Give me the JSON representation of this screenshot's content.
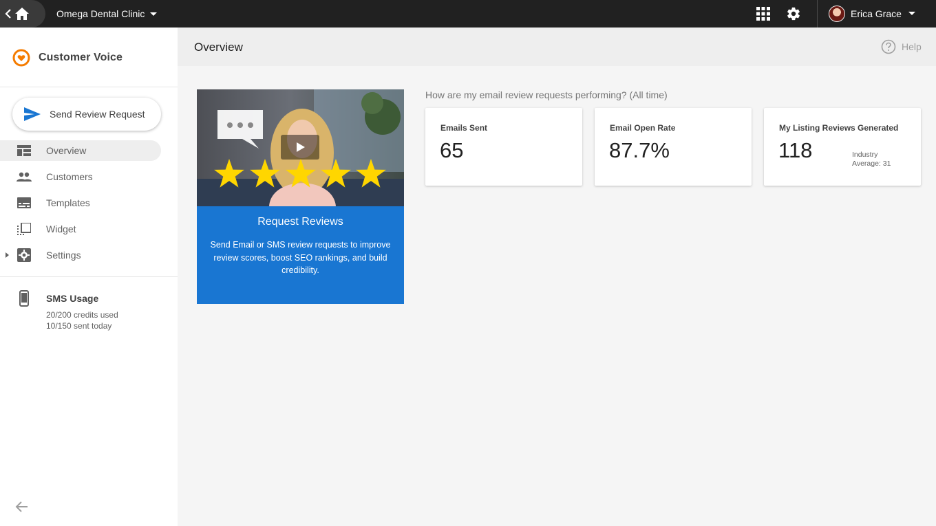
{
  "topbar": {
    "clinic_name": "Omega Dental Clinic",
    "user_name": "Erica Grace"
  },
  "sidebar": {
    "app_name": "Customer Voice",
    "send_button_label": "Send Review Request",
    "items": [
      {
        "label": "Overview",
        "icon": "dashboard-icon",
        "active": true
      },
      {
        "label": "Customers",
        "icon": "people-icon",
        "active": false
      },
      {
        "label": "Templates",
        "icon": "template-icon",
        "active": false
      },
      {
        "label": "Widget",
        "icon": "widget-icon",
        "active": false
      },
      {
        "label": "Settings",
        "icon": "settings-icon",
        "active": false
      }
    ],
    "sms": {
      "title": "SMS Usage",
      "credits": "20/200 credits used",
      "today": "10/150 sent today"
    }
  },
  "header": {
    "title": "Overview",
    "help_label": "Help"
  },
  "video_card": {
    "title": "Request Reviews",
    "description": "Send Email or SMS review requests to improve review scores, boost SEO rankings, and build credibility.",
    "stars": 5
  },
  "stats": {
    "question": "How are my email review requests performing? (All time)",
    "cards": [
      {
        "label": "Emails Sent",
        "value": "65"
      },
      {
        "label": "Email Open Rate",
        "value": "87.7%"
      },
      {
        "label": "My Listing Reviews Generated",
        "value": "118",
        "industry_label": "Industry",
        "industry_value": "Average: 31"
      }
    ]
  },
  "colors": {
    "topbar": "#212121",
    "accent_blue": "#1976d2",
    "brand_orange": "#f57c00",
    "star_yellow": "#ffd600"
  }
}
